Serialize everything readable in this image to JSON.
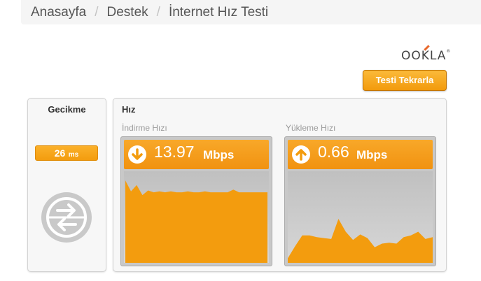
{
  "breadcrumb": {
    "items": [
      "Anasayfa",
      "Destek",
      "İnternet Hız Testi"
    ],
    "separator": "/"
  },
  "logo": {
    "text": "OOKLA"
  },
  "retest_button": {
    "label": "Testi Tekrarla"
  },
  "latency": {
    "title": "Gecikme",
    "value": "26",
    "unit": "ms",
    "icon": "ping-arrows-icon"
  },
  "speed": {
    "title": "Hız",
    "download": {
      "label": "İndirme Hızı",
      "value": "13.97",
      "unit": "Mbps",
      "icon": "download-arrow-icon",
      "samples": [
        0.9,
        0.78,
        0.85,
        0.74,
        0.79,
        0.77,
        0.78,
        0.77,
        0.78,
        0.77,
        0.77,
        0.78,
        0.77,
        0.77,
        0.78,
        0.77,
        0.77,
        0.77,
        0.77,
        0.8,
        0.77,
        0.77,
        0.77,
        0.77,
        0.77,
        0.77
      ]
    },
    "upload": {
      "label": "Yükleme Hızı",
      "value": "0.66",
      "unit": "Mbps",
      "icon": "upload-arrow-icon",
      "samples": [
        0.05,
        0.18,
        0.3,
        0.3,
        0.28,
        0.27,
        0.26,
        0.48,
        0.34,
        0.25,
        0.31,
        0.27,
        0.17,
        0.21,
        0.22,
        0.21,
        0.28,
        0.3,
        0.34,
        0.26,
        0.28
      ]
    },
    "accent_color": "#f39c0e"
  }
}
